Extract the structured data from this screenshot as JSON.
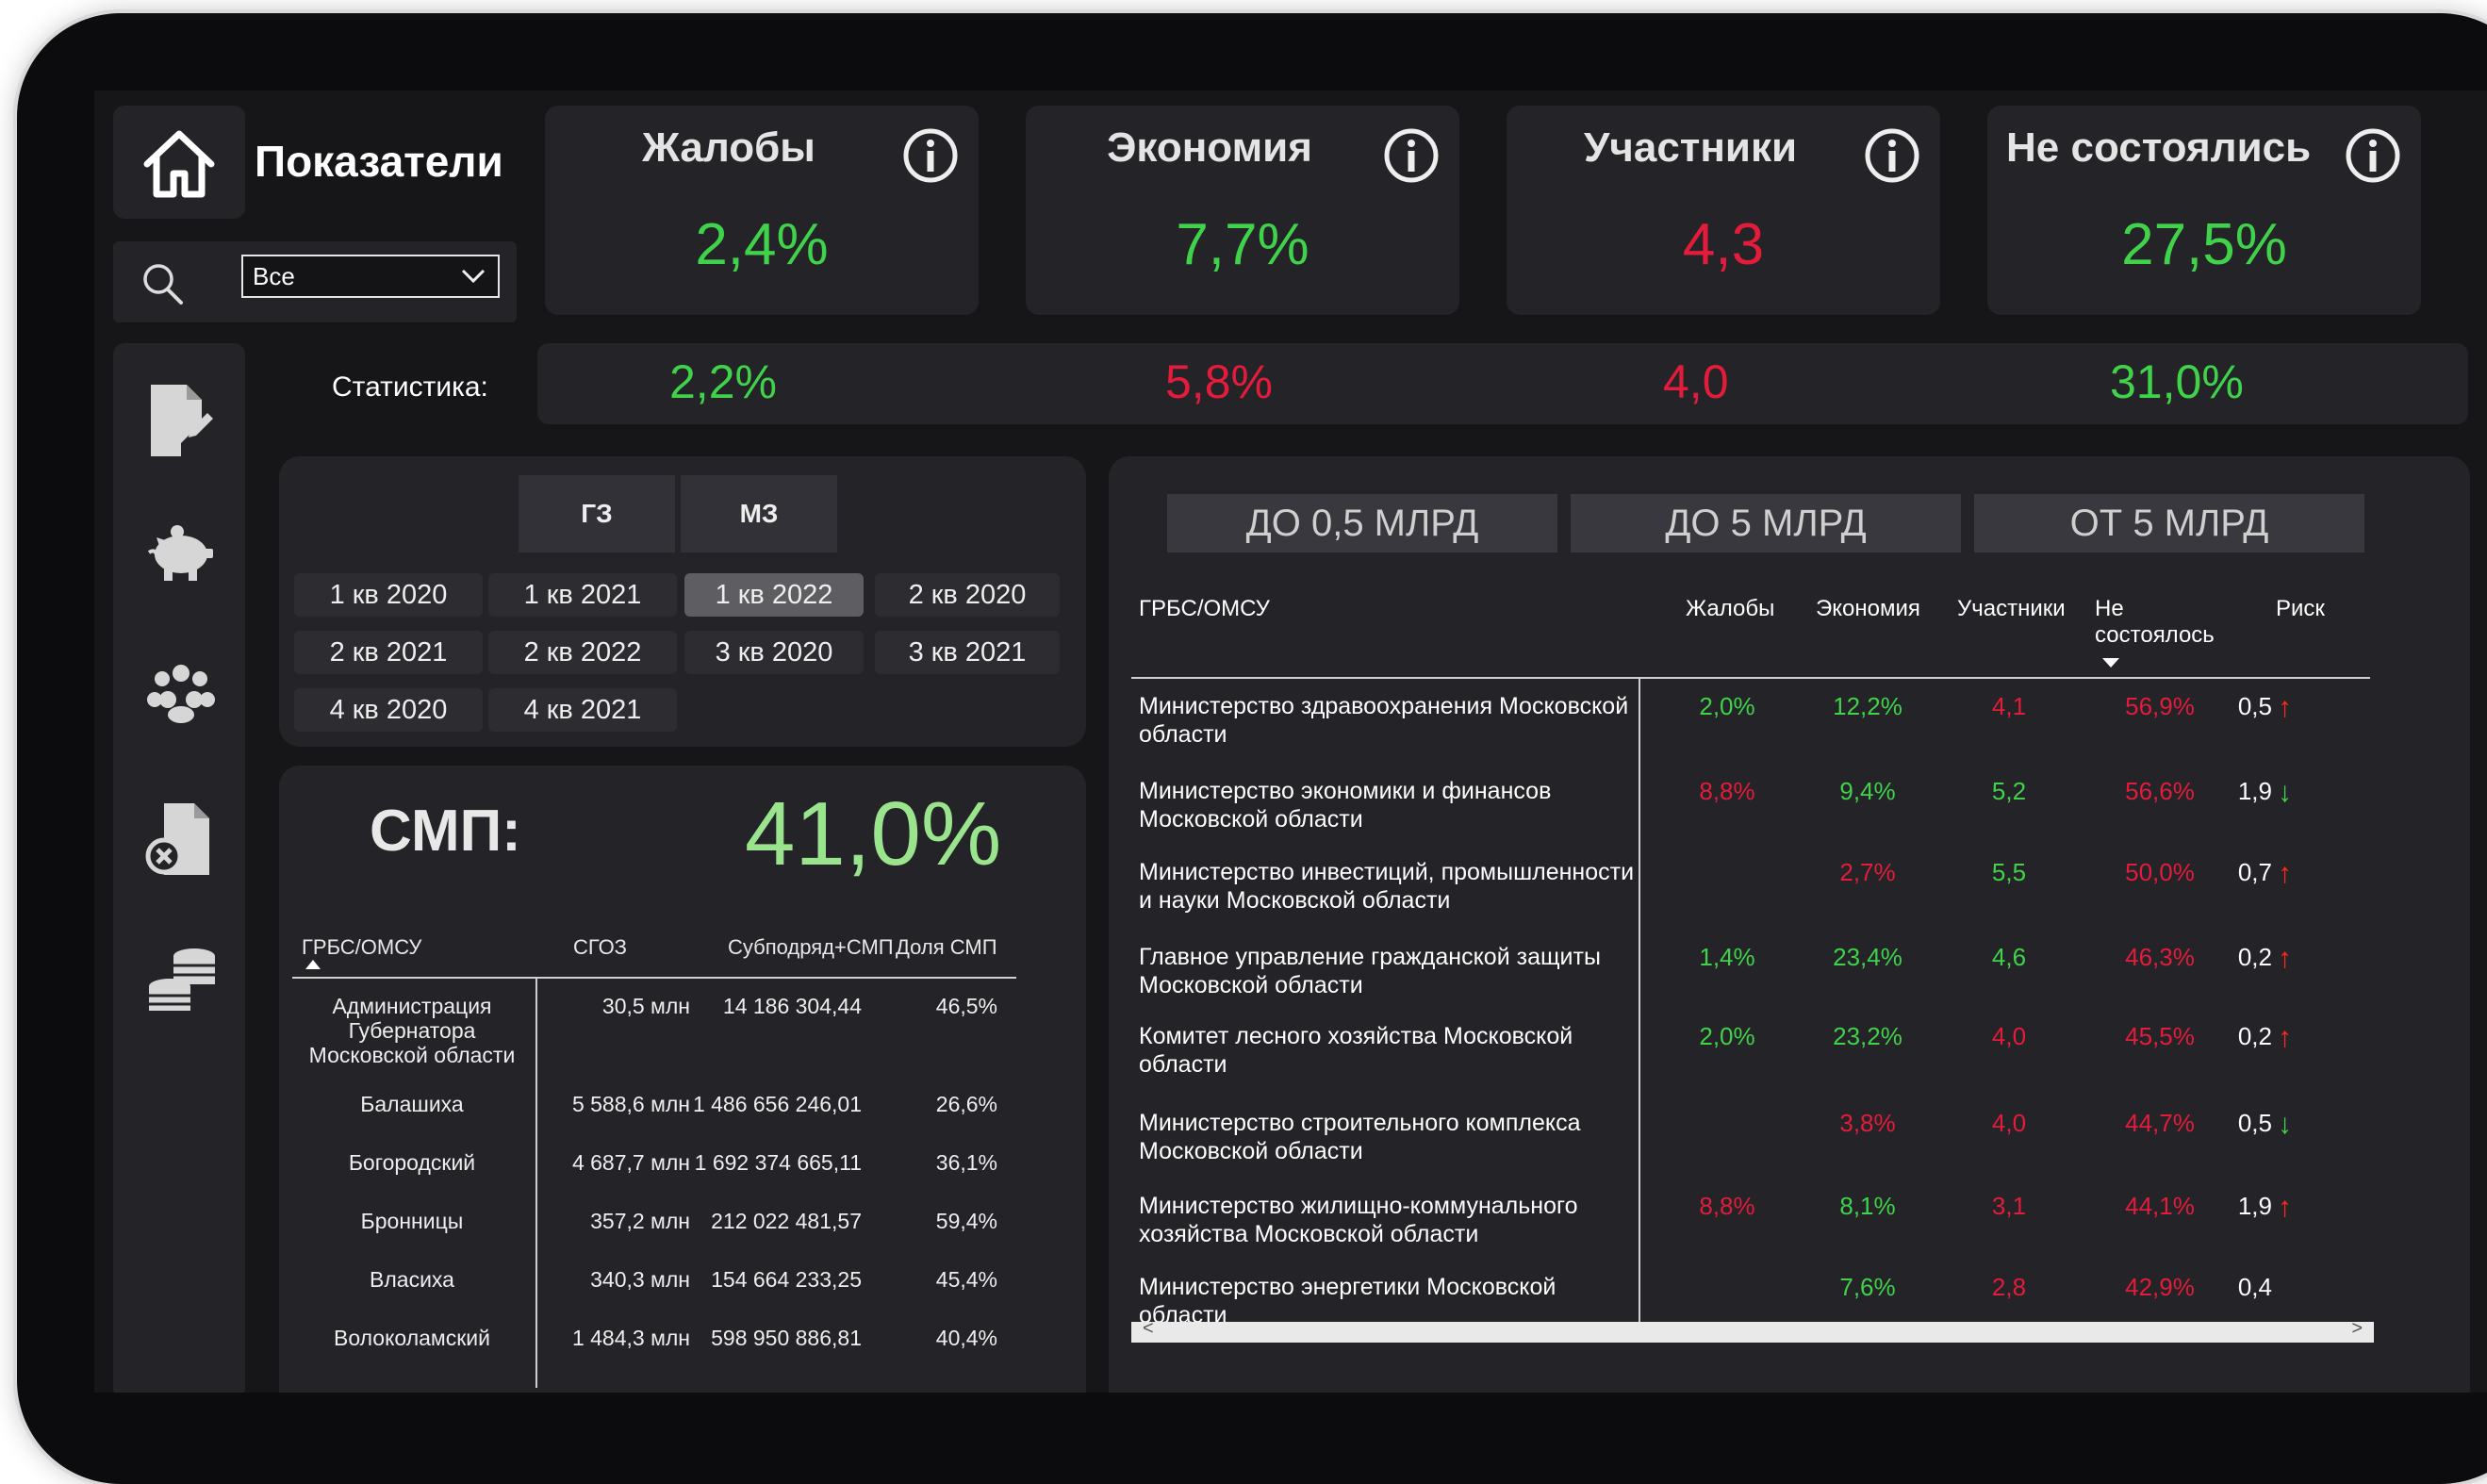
{
  "header": {
    "title": "Показатели"
  },
  "filter": {
    "selected": "Все"
  },
  "kpis": [
    {
      "label": "Жалобы",
      "value": "2,4%",
      "color": "#3fd24a"
    },
    {
      "label": "Экономия",
      "value": "7,7%",
      "color": "#3fd24a"
    },
    {
      "label": "Участники",
      "value": "4,3",
      "color": "#e21c3a"
    },
    {
      "label": "Не состоялись",
      "value": "27,5%",
      "color": "#3fd24a"
    }
  ],
  "statistics": {
    "label": "Статистика:",
    "values": [
      {
        "value": "2,2%",
        "color": "#3fd24a"
      },
      {
        "value": "5,8%",
        "color": "#e21c3a"
      },
      {
        "value": "4,0",
        "color": "#e21c3a"
      },
      {
        "value": "31,0%",
        "color": "#3fd24a"
      }
    ]
  },
  "sidebar": {
    "icons": [
      "document-edit-icon",
      "piggy-bank-icon",
      "people-icon",
      "document-cancel-icon",
      "coins-icon"
    ]
  },
  "quarters": {
    "tabs": [
      "ГЗ",
      "МЗ"
    ],
    "items": [
      "1 кв 2020",
      "1 кв 2021",
      "1 кв 2022",
      "2 кв 2020",
      "2 кв 2021",
      "2 кв 2022",
      "3 кв 2020",
      "3 кв 2021",
      "4 кв 2020",
      "4 кв 2021"
    ],
    "selected": "1 кв 2022"
  },
  "smp": {
    "label": "СМП:",
    "value": "41,0%",
    "columns": [
      "ГРБС/ОМСУ",
      "СГОЗ",
      "Субподряд+СМП",
      "Доля СМП"
    ],
    "rows": [
      {
        "name": "Администрация Губернатора Московской области",
        "sgoz": "30,5 млн",
        "sub": "14 186 304,44",
        "share": "46,5%"
      },
      {
        "name": "Балашиха",
        "sgoz": "5 588,6 млн",
        "sub": "1 486 656 246,01",
        "share": "26,6%"
      },
      {
        "name": "Богородский",
        "sgoz": "4 687,7 млн",
        "sub": "1 692 374 665,11",
        "share": "36,1%"
      },
      {
        "name": "Бронницы",
        "sgoz": "357,2 млн",
        "sub": "212 022 481,57",
        "share": "59,4%"
      },
      {
        "name": "Власиха",
        "sgoz": "340,3 млн",
        "sub": "154 664 233,25",
        "share": "45,4%"
      },
      {
        "name": "Волоколамский",
        "sgoz": "1 484,3 млн",
        "sub": "598 950 886,81",
        "share": "40,4%"
      }
    ]
  },
  "ranges": {
    "buttons": [
      "ДО 0,5 МЛРД",
      "ДО 5 МЛРД",
      "ОТ 5 МЛРД"
    ]
  },
  "table": {
    "columns": [
      "ГРБС/ОМСУ",
      "Жалобы",
      "Экономия",
      "Участники",
      "Не состоялось",
      "Риск"
    ],
    "rows": [
      {
        "org": "Министерство здравоохранения Московской области",
        "zh": "2,0%",
        "zhc": "#3fd24a",
        "ek": "12,2%",
        "ekc": "#3fd24a",
        "uch": "4,1",
        "uchc": "#e21c3a",
        "ns": "56,9%",
        "nsc": "#e21c3a",
        "risk": "0,5",
        "trend": "up"
      },
      {
        "org": "Министерство экономики и финансов Московской области",
        "zh": "8,8%",
        "zhc": "#e21c3a",
        "ek": "9,4%",
        "ekc": "#3fd24a",
        "uch": "5,2",
        "uchc": "#3fd24a",
        "ns": "56,6%",
        "nsc": "#e21c3a",
        "risk": "1,9",
        "trend": "down"
      },
      {
        "org": "Министерство инвестиций, промышленности и науки Московской области",
        "zh": "",
        "zhc": "#3fd24a",
        "ek": "2,7%",
        "ekc": "#e21c3a",
        "uch": "5,5",
        "uchc": "#3fd24a",
        "ns": "50,0%",
        "nsc": "#e21c3a",
        "risk": "0,7",
        "trend": "up"
      },
      {
        "org": "Главное управление гражданской защиты Московской области",
        "zh": "1,4%",
        "zhc": "#3fd24a",
        "ek": "23,4%",
        "ekc": "#3fd24a",
        "uch": "4,6",
        "uchc": "#3fd24a",
        "ns": "46,3%",
        "nsc": "#e21c3a",
        "risk": "0,2",
        "trend": "up"
      },
      {
        "org": "Комитет лесного хозяйства Московской области",
        "zh": "2,0%",
        "zhc": "#3fd24a",
        "ek": "23,2%",
        "ekc": "#3fd24a",
        "uch": "4,0",
        "uchc": "#e21c3a",
        "ns": "45,5%",
        "nsc": "#e21c3a",
        "risk": "0,2",
        "trend": "up"
      },
      {
        "org": "Министерство строительного комплекса Московской области",
        "zh": "",
        "zhc": "#3fd24a",
        "ek": "3,8%",
        "ekc": "#e21c3a",
        "uch": "4,0",
        "uchc": "#e21c3a",
        "ns": "44,7%",
        "nsc": "#e21c3a",
        "risk": "0,5",
        "trend": "down"
      },
      {
        "org": "Министерство жилищно-коммунального хозяйства Московской области",
        "zh": "8,8%",
        "zhc": "#e21c3a",
        "ek": "8,1%",
        "ekc": "#3fd24a",
        "uch": "3,1",
        "uchc": "#e21c3a",
        "ns": "44,1%",
        "nsc": "#e21c3a",
        "risk": "1,9",
        "trend": "up"
      },
      {
        "org": "Министерство энергетики Московской области",
        "zh": "",
        "zhc": "#3fd24a",
        "ek": "7,6%",
        "ekc": "#3fd24a",
        "uch": "2,8",
        "uchc": "#e21c3a",
        "ns": "42,9%",
        "nsc": "#e21c3a",
        "risk": "0,4",
        "trend": "none"
      }
    ]
  }
}
